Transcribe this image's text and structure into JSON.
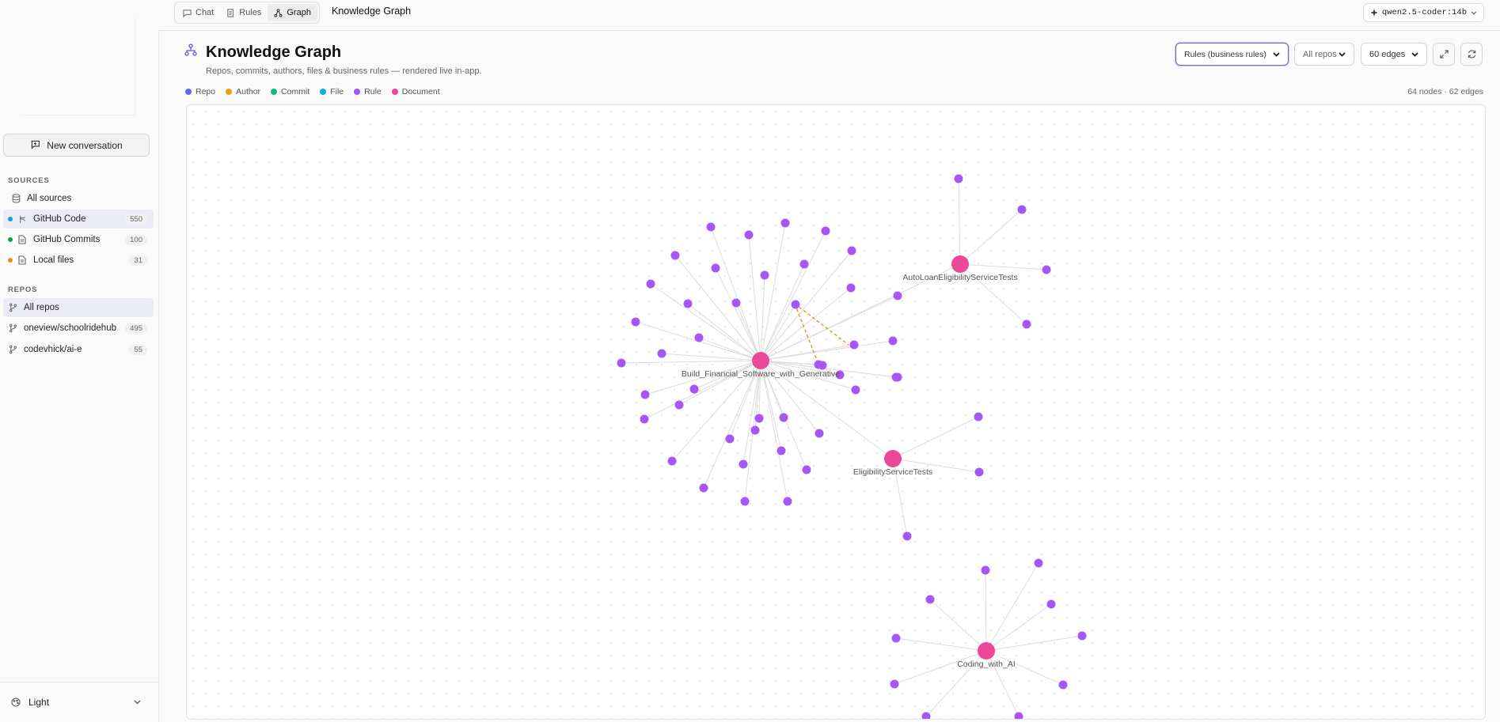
{
  "tabs": [
    {
      "label": "Chat",
      "icon": "chat-icon"
    },
    {
      "label": "Rules",
      "icon": "rules-icon"
    },
    {
      "label": "Graph",
      "icon": "graph-icon"
    }
  ],
  "top_title": "Knowledge Graph",
  "model": "qwen2.5-coder:14b",
  "sidebar": {
    "new_conversation": "New conversation",
    "sources_label": "SOURCES",
    "sources": [
      {
        "label": "All sources",
        "count": "",
        "icon": "database-icon"
      },
      {
        "label": "GitHub Code",
        "count": "550",
        "dot": "#0ea5c6",
        "icon": "github-icon"
      },
      {
        "label": "GitHub Commits",
        "count": "100",
        "dot": "#16a34a",
        "icon": "document-icon"
      },
      {
        "label": "Local files",
        "count": "31",
        "dot": "#ea8c1a",
        "icon": "document-icon"
      }
    ],
    "repos_label": "REPOS",
    "repos": [
      {
        "label": "All repos",
        "count": ""
      },
      {
        "label": "oneview/schoolridehub",
        "count": "495"
      },
      {
        "label": "codevhick/ai-e",
        "count": "55"
      }
    ],
    "theme": "Light"
  },
  "header": {
    "title": "Knowledge Graph",
    "subtitle": "Repos, commits, authors, files & business rules — rendered live in-app.",
    "view_select": "Rules (business rules)",
    "repo_select": "All repos",
    "edges_select": "60 edges"
  },
  "legend": [
    {
      "label": "Repo",
      "color": "#6366f1"
    },
    {
      "label": "Author",
      "color": "#f59e0b"
    },
    {
      "label": "Commit",
      "color": "#10b981"
    },
    {
      "label": "File",
      "color": "#06b6d4"
    },
    {
      "label": "Rule",
      "color": "#a855f7"
    },
    {
      "label": "Document",
      "color": "#ec4899"
    }
  ],
  "stats": "64 nodes · 62 edges",
  "graph": {
    "hubs": [
      {
        "label": "Build_Financial_Software_with_Generative",
        "type": "Document"
      },
      {
        "label": "AutoLoanEligibilityServiceTests",
        "type": "Document"
      },
      {
        "label": "EligibilityServiceTests",
        "type": "Document"
      },
      {
        "label": "Coding_with_AI",
        "type": "Document"
      }
    ]
  }
}
